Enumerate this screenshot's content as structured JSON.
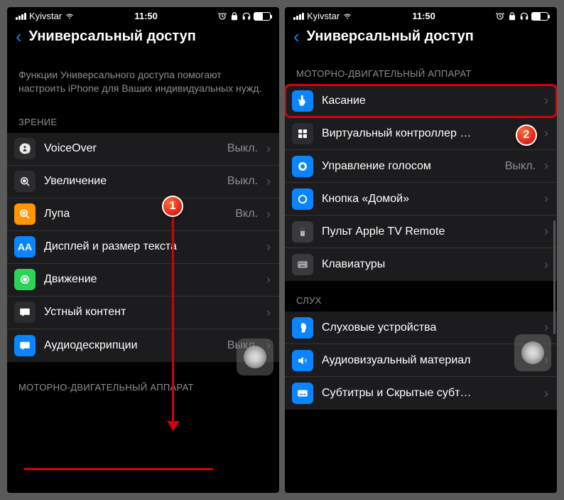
{
  "status": {
    "carrier": "Kyivstar",
    "time": "11:50"
  },
  "nav": {
    "title": "Универсальный доступ"
  },
  "left": {
    "intro": "Функции Универсального доступа помогают настроить iPhone для Ваших индивидуальных нужд.",
    "section_vision": "ЗРЕНИЕ",
    "rows": {
      "voiceover": {
        "label": "VoiceOver",
        "value": "Выкл."
      },
      "zoom": {
        "label": "Увеличение",
        "value": "Выкл."
      },
      "magnifier": {
        "label": "Лупа",
        "value": "Вкл."
      },
      "display": {
        "label": "Дисплей и размер текста",
        "value": ""
      },
      "motion": {
        "label": "Движение",
        "value": ""
      },
      "spoken": {
        "label": "Устный контент",
        "value": ""
      },
      "audiodesc": {
        "label": "Аудиодескрипции",
        "value": "Выкл."
      }
    },
    "section_motor": "МОТОРНО-ДВИГАТЕЛЬНЫЙ АППАРАТ"
  },
  "right": {
    "section_motor": "МОТОРНО-ДВИГАТЕЛЬНЫЙ АППАРАТ",
    "rows": {
      "touch": {
        "label": "Касание",
        "value": ""
      },
      "switch": {
        "label": "Виртуальный контроллер  …",
        "value": ""
      },
      "voice": {
        "label": "Управление голосом",
        "value": "Выкл."
      },
      "home": {
        "label": "Кнопка «Домой»",
        "value": ""
      },
      "tv": {
        "label": "Пульт Apple TV Remote",
        "value": ""
      },
      "keyboard": {
        "label": "Клавиатуры",
        "value": ""
      }
    },
    "section_hearing": "СЛУХ",
    "hearing_rows": {
      "devices": {
        "label": "Слуховые устройства",
        "value": ""
      },
      "av": {
        "label": "Аудиовизуальный материал",
        "value": ""
      },
      "subtitles": {
        "label": "Субтитры и Скрытые субт…",
        "value": ""
      }
    }
  },
  "callouts": {
    "one": "1",
    "two": "2"
  }
}
